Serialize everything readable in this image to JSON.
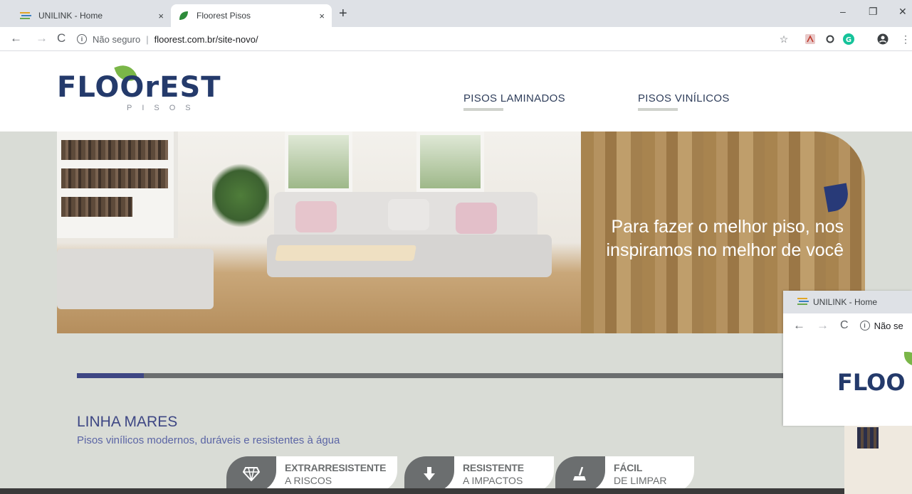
{
  "browser": {
    "tabs": [
      {
        "title": "UNILINK - Home",
        "icon": "unilink-icon",
        "active": false
      },
      {
        "title": "Floorest Pisos",
        "icon": "leaf-icon",
        "active": true
      }
    ],
    "close_glyph": "×",
    "newtab_glyph": "+",
    "address": {
      "security_label": "Não seguro",
      "url": "floorest.com.br/site-novo/"
    },
    "window_controls": {
      "minimize": "–",
      "maximize": "❐",
      "close": "✕"
    },
    "extension_icons": [
      "star-icon",
      "pdf-icon",
      "circle-extension-icon",
      "grammarly-icon",
      "account-icon",
      "menu-icon"
    ]
  },
  "site": {
    "logo_text": "FLOOrEST",
    "logo_sub": "PISOS",
    "menu": [
      {
        "label": "PISOS LAMINADOS"
      },
      {
        "label": "PISOS VINÍLICOS"
      }
    ],
    "hero": {
      "headline": "Para fazer o melhor piso, nos inspiramos no melhor de você"
    },
    "line": {
      "title": "LINHA MARES",
      "subtitle": "Pisos vinílicos modernos, duráveis e resistentes à água",
      "progress_fraction": 0.094
    },
    "features": [
      {
        "title": "EXTRARRESISTENTE",
        "subtitle": "A RISCOS",
        "icon": "diamond-icon"
      },
      {
        "title": "RESISTENTE",
        "subtitle": "A IMPACTOS",
        "icon": "arrow-down-icon"
      },
      {
        "title": "FÁCIL",
        "subtitle": "DE LIMPAR",
        "icon": "mop-icon"
      }
    ]
  },
  "overlay_window": {
    "tab_title": "UNILINK - Home",
    "security_label": "Não se",
    "logo_text": "FLOO"
  },
  "colors": {
    "brand_navy": "#243a6b",
    "accent_blue": "#3e4784",
    "leaf_green": "#7ab648",
    "page_bg": "#d9dcd6"
  }
}
